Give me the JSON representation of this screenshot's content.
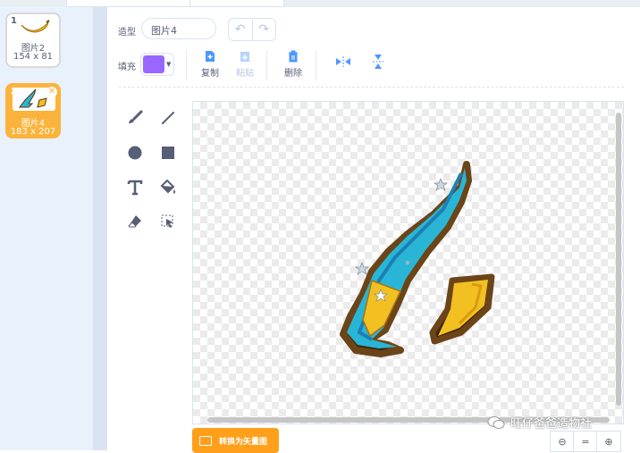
{
  "sidebar": {
    "costumes": [
      {
        "number": "1",
        "name": "图片2",
        "size": "154 x 81"
      },
      {
        "number": "2",
        "name": "图片4",
        "size": "183 x 207"
      }
    ]
  },
  "toolbar": {
    "costume_label": "造型",
    "costume_name": "图片4",
    "fill_label": "填充",
    "fill_color": "#9966ff",
    "copy_label": "复制",
    "paste_label": "粘贴",
    "delete_label": "删除"
  },
  "canvas": {
    "convert_button": "转换为矢量图",
    "zoom_out": "⊖",
    "zoom_reset": "=",
    "zoom_in": "⊕"
  },
  "watermark": {
    "text": "旺仔爸爸造物社"
  },
  "colors": {
    "accent": "#ff9f1a",
    "selected": "#fbb33c",
    "sidebar_bg": "#e9f1fc"
  }
}
